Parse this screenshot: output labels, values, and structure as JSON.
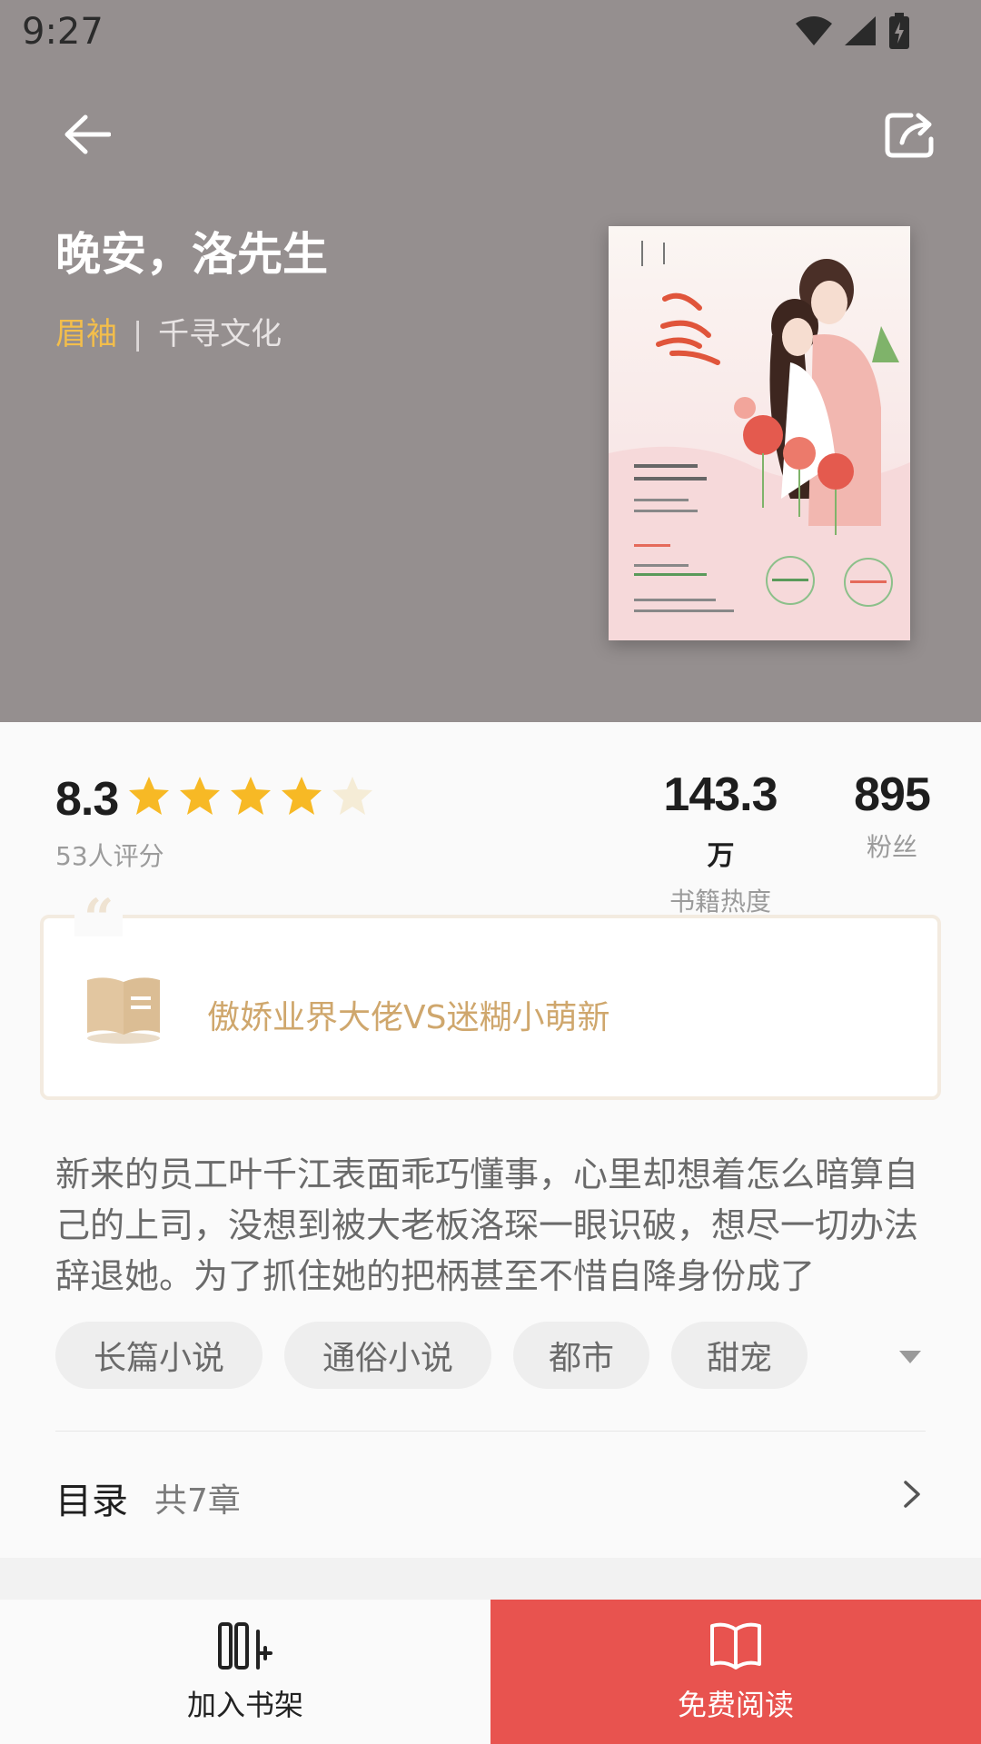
{
  "status_bar": {
    "time": "9:27"
  },
  "book": {
    "title": "晚安，洛先生",
    "author": "眉袖",
    "separator": "|",
    "publisher": "千寻文化"
  },
  "rating": {
    "score": "8.3",
    "stars_filled": 4,
    "stars_total": 5,
    "count_label": "53人评分"
  },
  "stats": [
    {
      "value": "143.3",
      "unit": "万",
      "label": "书籍热度"
    },
    {
      "value": "895",
      "unit": "",
      "label": "粉丝"
    }
  ],
  "quote": {
    "mark": "“",
    "text": "傲娇业界大佬VS迷糊小萌新"
  },
  "synopsis": "新来的员工叶千江表面乖巧懂事，心里却想着怎么暗算自己的上司，没想到被大老板洛琛一眼识破，想尽一切办法辞退她。为了抓住她的把柄甚至不惜自降身份成了",
  "tags": [
    "长篇小说",
    "通俗小说",
    "都市",
    "甜宠"
  ],
  "toc": {
    "label": "目录",
    "count": "共7章"
  },
  "bottom": {
    "shelf_label": "加入书架",
    "read_label": "免费阅读"
  },
  "colors": {
    "hero_bg": "#958f8f",
    "author": "#f3be4b",
    "accent_red": "#e8534f",
    "quote_text": "#cfa76d",
    "star": "#f7b925"
  }
}
